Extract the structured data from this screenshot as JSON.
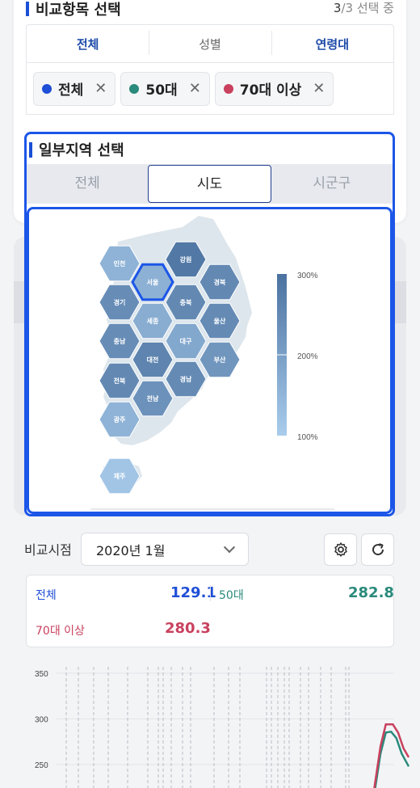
{
  "compare": {
    "title": "비교항목 선택",
    "count_current": "3",
    "count_rest": "/3 선택 중",
    "tabs": [
      {
        "label": "전체",
        "active": true
      },
      {
        "label": "성별",
        "active": false
      },
      {
        "label": "연령대",
        "active": true
      }
    ],
    "chips": [
      {
        "label": "전체",
        "color": "#1f4fd6"
      },
      {
        "label": "50대",
        "color": "#2a8a7c"
      },
      {
        "label": "70대 이상",
        "color": "#c9415e"
      }
    ],
    "remove_glyph": "✕"
  },
  "region": {
    "title": "일부지역 선택",
    "tabs": [
      {
        "label": "전체",
        "active": false
      },
      {
        "label": "시도",
        "active": true
      },
      {
        "label": "시군구",
        "active": false
      }
    ],
    "selected": "서울",
    "hexes": [
      {
        "name": "인천",
        "level": 1.55
      },
      {
        "name": "서울",
        "level": 1.6
      },
      {
        "name": "강원",
        "level": 2.85
      },
      {
        "name": "경북",
        "level": 2.5
      },
      {
        "name": "경기",
        "level": 2.4
      },
      {
        "name": "세종",
        "level": 1.7
      },
      {
        "name": "충북",
        "level": 2.5
      },
      {
        "name": "울산",
        "level": 2.45
      },
      {
        "name": "충남",
        "level": 2.4
      },
      {
        "name": "대구",
        "level": 1.8
      },
      {
        "name": "대전",
        "level": 2.6
      },
      {
        "name": "부산",
        "level": 2.2
      },
      {
        "name": "전북",
        "level": 2.5
      },
      {
        "name": "경남",
        "level": 2.45
      },
      {
        "name": "전남",
        "level": 2.3
      },
      {
        "name": "광주",
        "level": 1.55
      },
      {
        "name": "제주",
        "level": 1.15
      }
    ],
    "legend": {
      "max": "300%",
      "mid": "200%",
      "min": "100%",
      "color_high": "#4b72a0",
      "color_low": "#a9ccec"
    }
  },
  "period": {
    "label": "비교시점",
    "value": "2020년 1월",
    "settings_icon": "gear-icon",
    "refresh_icon": "refresh-icon"
  },
  "stats": [
    {
      "label": "전체",
      "value": "129.1",
      "color": "#1f4fd6"
    },
    {
      "label": "50대",
      "value": "282.8",
      "color": "#2a8a7c"
    },
    {
      "label": "70대 이상",
      "value": "280.3",
      "color": "#c9415e"
    }
  ],
  "chart_data": {
    "type": "line",
    "yticks": [
      "350",
      "300",
      "250"
    ],
    "ylim": [
      200,
      350
    ],
    "series": [
      {
        "name": "50대",
        "color": "#2a8a7c",
        "points": [
          [
            0.88,
            198
          ],
          [
            0.9,
            212
          ],
          [
            0.92,
            262
          ],
          [
            0.935,
            285
          ],
          [
            0.95,
            286
          ],
          [
            0.965,
            279
          ],
          [
            0.98,
            262
          ],
          [
            1.0,
            248
          ]
        ]
      },
      {
        "name": "70대 이상",
        "color": "#c9415e",
        "points": [
          [
            0.88,
            196
          ],
          [
            0.9,
            218
          ],
          [
            0.92,
            270
          ],
          [
            0.935,
            294
          ],
          [
            0.955,
            294
          ],
          [
            0.97,
            285
          ],
          [
            0.985,
            268
          ],
          [
            1.0,
            258
          ]
        ]
      }
    ]
  }
}
